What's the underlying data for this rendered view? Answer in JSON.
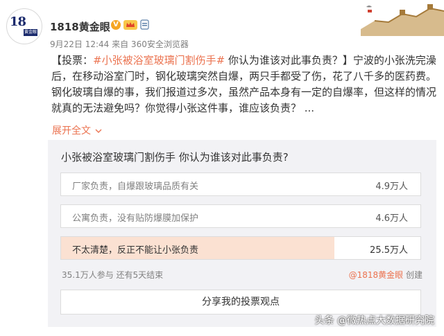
{
  "post": {
    "author": {
      "name": "1818黄金眼",
      "avatar_text": "18",
      "avatar_badge": "黄金眼"
    },
    "meta": "9月22日 12:44 来自 360安全浏览器",
    "text": {
      "prefix": "【投票：",
      "topic": "#小张被浴室玻璃门割伤手#",
      "body": " 你认为谁该对此事负责？】宁波的小张洗完澡后，在移动浴室门时，钢化玻璃突然自爆，两只手都受了伤，花了八千多的医药费。钢化玻璃自爆的事，我们报道过多次，虽然产品本身有一定的自爆率，但这样的情况就真的无法避免吗？你觉得小张这件事，谁应该负责？ ..."
    },
    "expand_label": "展开全文",
    "colors": {
      "link": "#eb7350",
      "selected_fill": "#fbe1d2",
      "verified": "#f6a623"
    }
  },
  "poll": {
    "title": "小张被浴室玻璃门割伤手 你认为谁该对此事负责?",
    "options": [
      {
        "label": "厂家负责，自爆跟玻璃品质有关",
        "count": "4.9万人",
        "selected": false
      },
      {
        "label": "公寓负责，没有贴防爆膜加保护",
        "count": "4.6万人",
        "selected": false
      },
      {
        "label": "不太清楚，反正不能让小张负责",
        "count": "25.5万人",
        "selected": true,
        "fill_fraction": 0.76
      }
    ],
    "footer": "35.1万人参与 还有5天结束",
    "creator_link": "@1818黄金眼",
    "creator_suffix": " 创建",
    "share_label": "分享我的投票观点"
  },
  "watermark": "头条 @微热点大数据研究院"
}
